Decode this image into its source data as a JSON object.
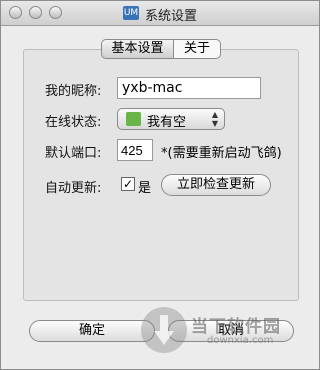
{
  "window": {
    "title": "系统设置",
    "app_logo": "UM"
  },
  "tabs": [
    {
      "label": "基本设置"
    },
    {
      "label": "关于"
    }
  ],
  "form": {
    "nickname": {
      "label": "我的昵称:",
      "value": "yxb-mac"
    },
    "status": {
      "label": "在线状态:",
      "selected": "我有空",
      "icon": "green-status-icon"
    },
    "port": {
      "label": "默认端口:",
      "value": "425",
      "note": "*(需要重新启动飞鸽)"
    },
    "auto_update": {
      "label": "自动更新:",
      "checkbox_label": "是",
      "checked": true,
      "check_button": "立即检查更新"
    }
  },
  "footer": {
    "ok": "确定",
    "cancel": "取消"
  },
  "watermark": {
    "title": "当下软件园",
    "subtitle": "downxia.com"
  }
}
